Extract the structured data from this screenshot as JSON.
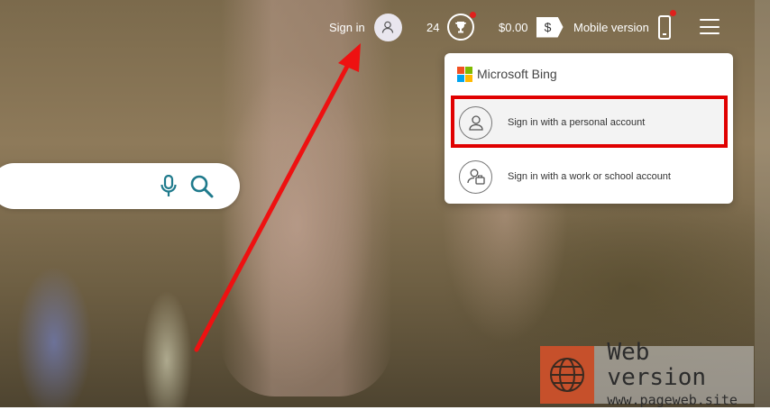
{
  "header": {
    "sign_in_label": "Sign in",
    "rewards_count": "24",
    "balance": "$0.00",
    "dollar_symbol": "$",
    "mobile_label": "Mobile version"
  },
  "search": {
    "placeholder": ""
  },
  "flyout": {
    "brand": "Microsoft Bing",
    "options": [
      {
        "label": "Sign in with a personal account",
        "icon": "person-icon"
      },
      {
        "label": "Sign in with a work or school account",
        "icon": "work-account-icon"
      }
    ]
  },
  "watermark": {
    "line1": "Web version",
    "line2": "www.pageweb.site"
  },
  "colors": {
    "annotation_red": "#e00000",
    "notification_dot": "#e0201c",
    "search_icon_teal": "#1f7a8c",
    "ms_logo": [
      "#f25022",
      "#7fba00",
      "#00a4ef",
      "#ffb900"
    ]
  }
}
